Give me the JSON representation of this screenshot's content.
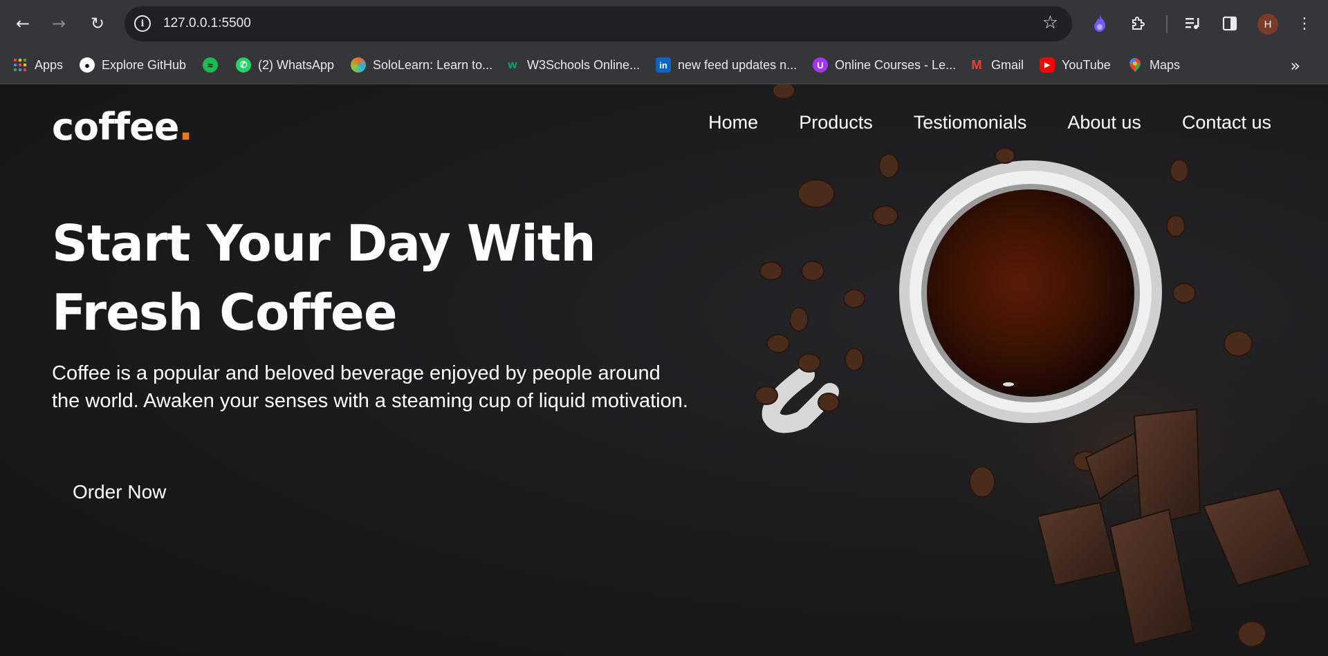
{
  "browser": {
    "url": "127.0.0.1:5500",
    "avatar_letter": "H",
    "bookmarks": [
      {
        "label": "Apps",
        "icon": "apps-grid-icon",
        "color": "#e94235"
      },
      {
        "label": "Explore GitHub",
        "icon": "github-icon",
        "color": "#ffffff"
      },
      {
        "label": "",
        "icon": "spotify-icon",
        "color": "#1db954"
      },
      {
        "label": "(2) WhatsApp",
        "icon": "whatsapp-icon",
        "color": "#25d366"
      },
      {
        "label": "SoloLearn: Learn to...",
        "icon": "sololearn-icon",
        "color": "#f36c21"
      },
      {
        "label": "W3Schools Online...",
        "icon": "w3schools-icon",
        "color": "#04aa6d"
      },
      {
        "label": "new feed updates n...",
        "icon": "linkedin-icon",
        "color": "#0a66c2"
      },
      {
        "label": "Online Courses - Le...",
        "icon": "udemy-icon",
        "color": "#a435f0"
      },
      {
        "label": "Gmail",
        "icon": "gmail-icon",
        "color": "#ea4335"
      },
      {
        "label": "YouTube",
        "icon": "youtube-icon",
        "color": "#ff0000"
      },
      {
        "label": "Maps",
        "icon": "maps-icon",
        "color": "#34a853"
      }
    ]
  },
  "site": {
    "logo_text": "coffee",
    "logo_dot": ".",
    "accent_color": "#e07c24",
    "nav": [
      "Home",
      "Products",
      "Testiomonials",
      "About us",
      "Contact us"
    ],
    "hero_title": "Start Your Day With Fresh Coffee",
    "hero_text": "Coffee is a popular and beloved beverage enjoyed by people around the world. Awaken your senses with a steaming cup of liquid motivation.",
    "cta_label": "Order Now"
  }
}
